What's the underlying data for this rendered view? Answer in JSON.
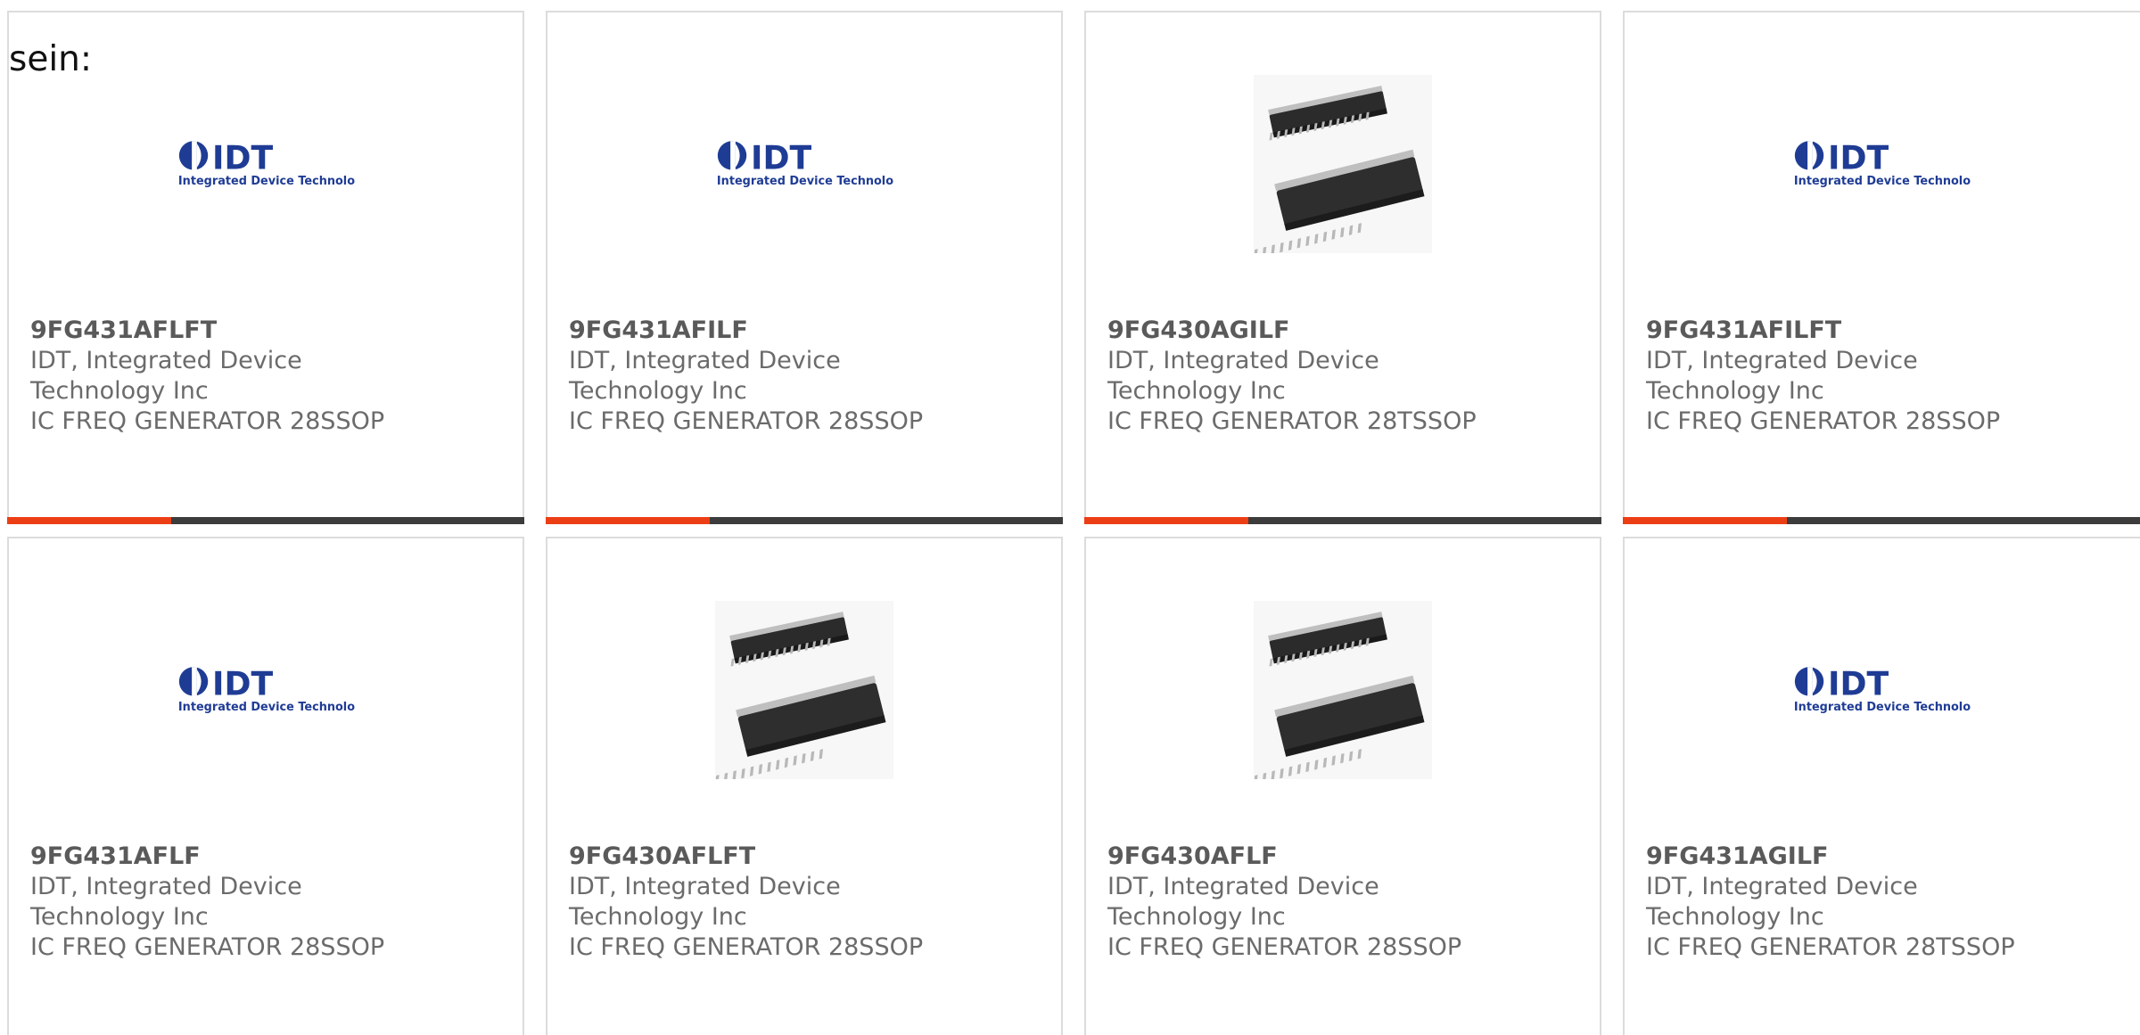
{
  "intro_text": "sein:",
  "colors": {
    "accent": "#ec3e15",
    "bar": "#3c3c3c",
    "border": "#dcdcdc",
    "text": "#6b6b6b",
    "idt_blue": "#1f3c95"
  },
  "logo": {
    "mark": "IDT",
    "tagline": "Integrated Device Technology"
  },
  "products": [
    {
      "part_number": "9FG431AFLFT",
      "manufacturer_line1": "IDT, Integrated Device",
      "manufacturer_line2": "Technology Inc",
      "description": "IC FREQ GENERATOR 28SSOP",
      "image": "idt-logo"
    },
    {
      "part_number": "9FG431AFILF",
      "manufacturer_line1": "IDT, Integrated Device",
      "manufacturer_line2": "Technology Inc",
      "description": "IC FREQ GENERATOR 28SSOP",
      "image": "idt-logo"
    },
    {
      "part_number": "9FG430AGILF",
      "manufacturer_line1": "IDT, Integrated Device",
      "manufacturer_line2": "Technology Inc",
      "description": "IC FREQ GENERATOR 28TSSOP",
      "image": "chip-photo"
    },
    {
      "part_number": "9FG431AFILFT",
      "manufacturer_line1": "IDT, Integrated Device",
      "manufacturer_line2": "Technology Inc",
      "description": "IC FREQ GENERATOR 28SSOP",
      "image": "idt-logo"
    },
    {
      "part_number": "9FG431AFLF",
      "manufacturer_line1": "IDT, Integrated Device",
      "manufacturer_line2": "Technology Inc",
      "description": "IC FREQ GENERATOR 28SSOP",
      "image": "idt-logo"
    },
    {
      "part_number": "9FG430AFLFT",
      "manufacturer_line1": "IDT, Integrated Device",
      "manufacturer_line2": "Technology Inc",
      "description": "IC FREQ GENERATOR 28SSOP",
      "image": "chip-photo"
    },
    {
      "part_number": "9FG430AFLF",
      "manufacturer_line1": "IDT, Integrated Device",
      "manufacturer_line2": "Technology Inc",
      "description": "IC FREQ GENERATOR 28SSOP",
      "image": "chip-photo"
    },
    {
      "part_number": "9FG431AGILF",
      "manufacturer_line1": "IDT, Integrated Device",
      "manufacturer_line2": "Technology Inc",
      "description": "IC FREQ GENERATOR 28TSSOP",
      "image": "idt-logo"
    }
  ]
}
